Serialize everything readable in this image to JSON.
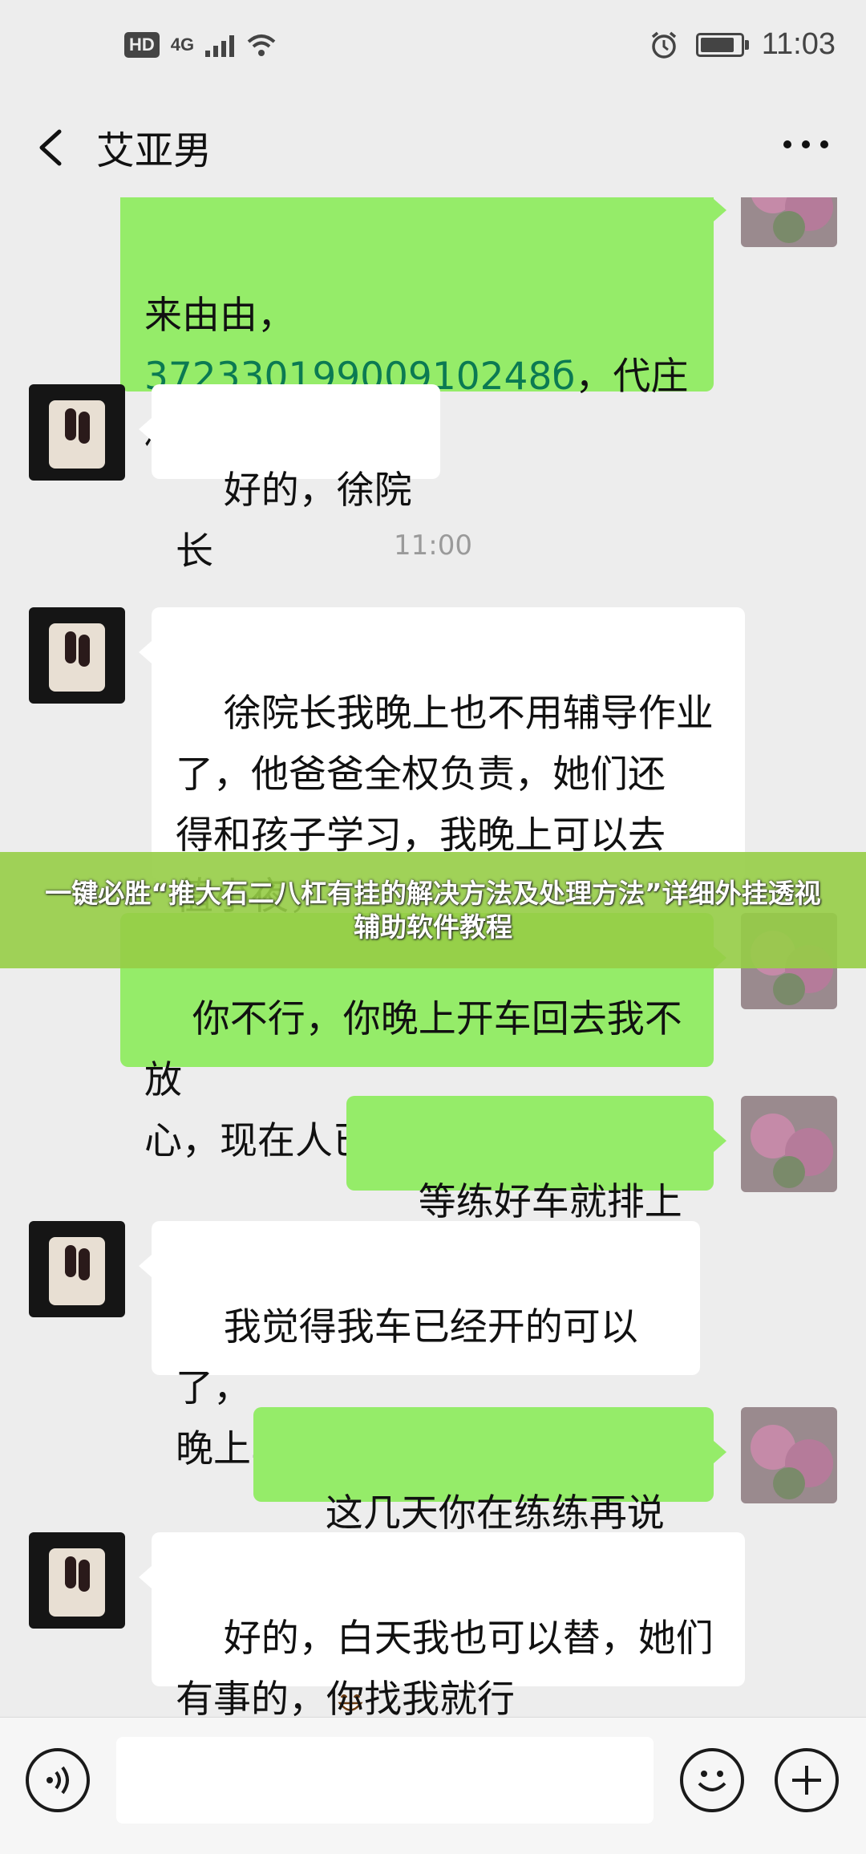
{
  "status_bar": {
    "hd": "HD",
    "network": "4G",
    "time": "11:03",
    "battery_level": 0.85
  },
  "header": {
    "contact_name": "艾亚男"
  },
  "messages": {
    "m1_line1": "来由由，",
    "m1_id": "37233019900910248б",
    "m1_rest": "，代庄\n村居住",
    "m2": "好的，徐院长",
    "ts1": "11:00",
    "m3": "徐院长我晚上也不用辅导作业\n了，他爸爸全权负责，她们还\n得和孩子学习，我晚上可以去\n值小夜，",
    "m4": "你不行，你晚上开车回去我不放\n心，现在人已经不少了啊",
    "m5": "等练好车就排上你",
    "m6": "我觉得我车已经开的可以了，\n晚上车就少了",
    "m7": "这几天你在练练再说",
    "m8": "好的，白天我也可以替，她们\n有事的，你找我就行"
  },
  "banner": {
    "text": "一键必胜“推大石二八杠有挂的解决方法及处理方法”详细外挂透视辅助软件教程"
  },
  "input_bar": {
    "placeholder": ""
  },
  "colors": {
    "sent_bubble": "#95ec69",
    "received_bubble": "#ffffff",
    "background": "#ededed",
    "banner": "#96cd46"
  }
}
